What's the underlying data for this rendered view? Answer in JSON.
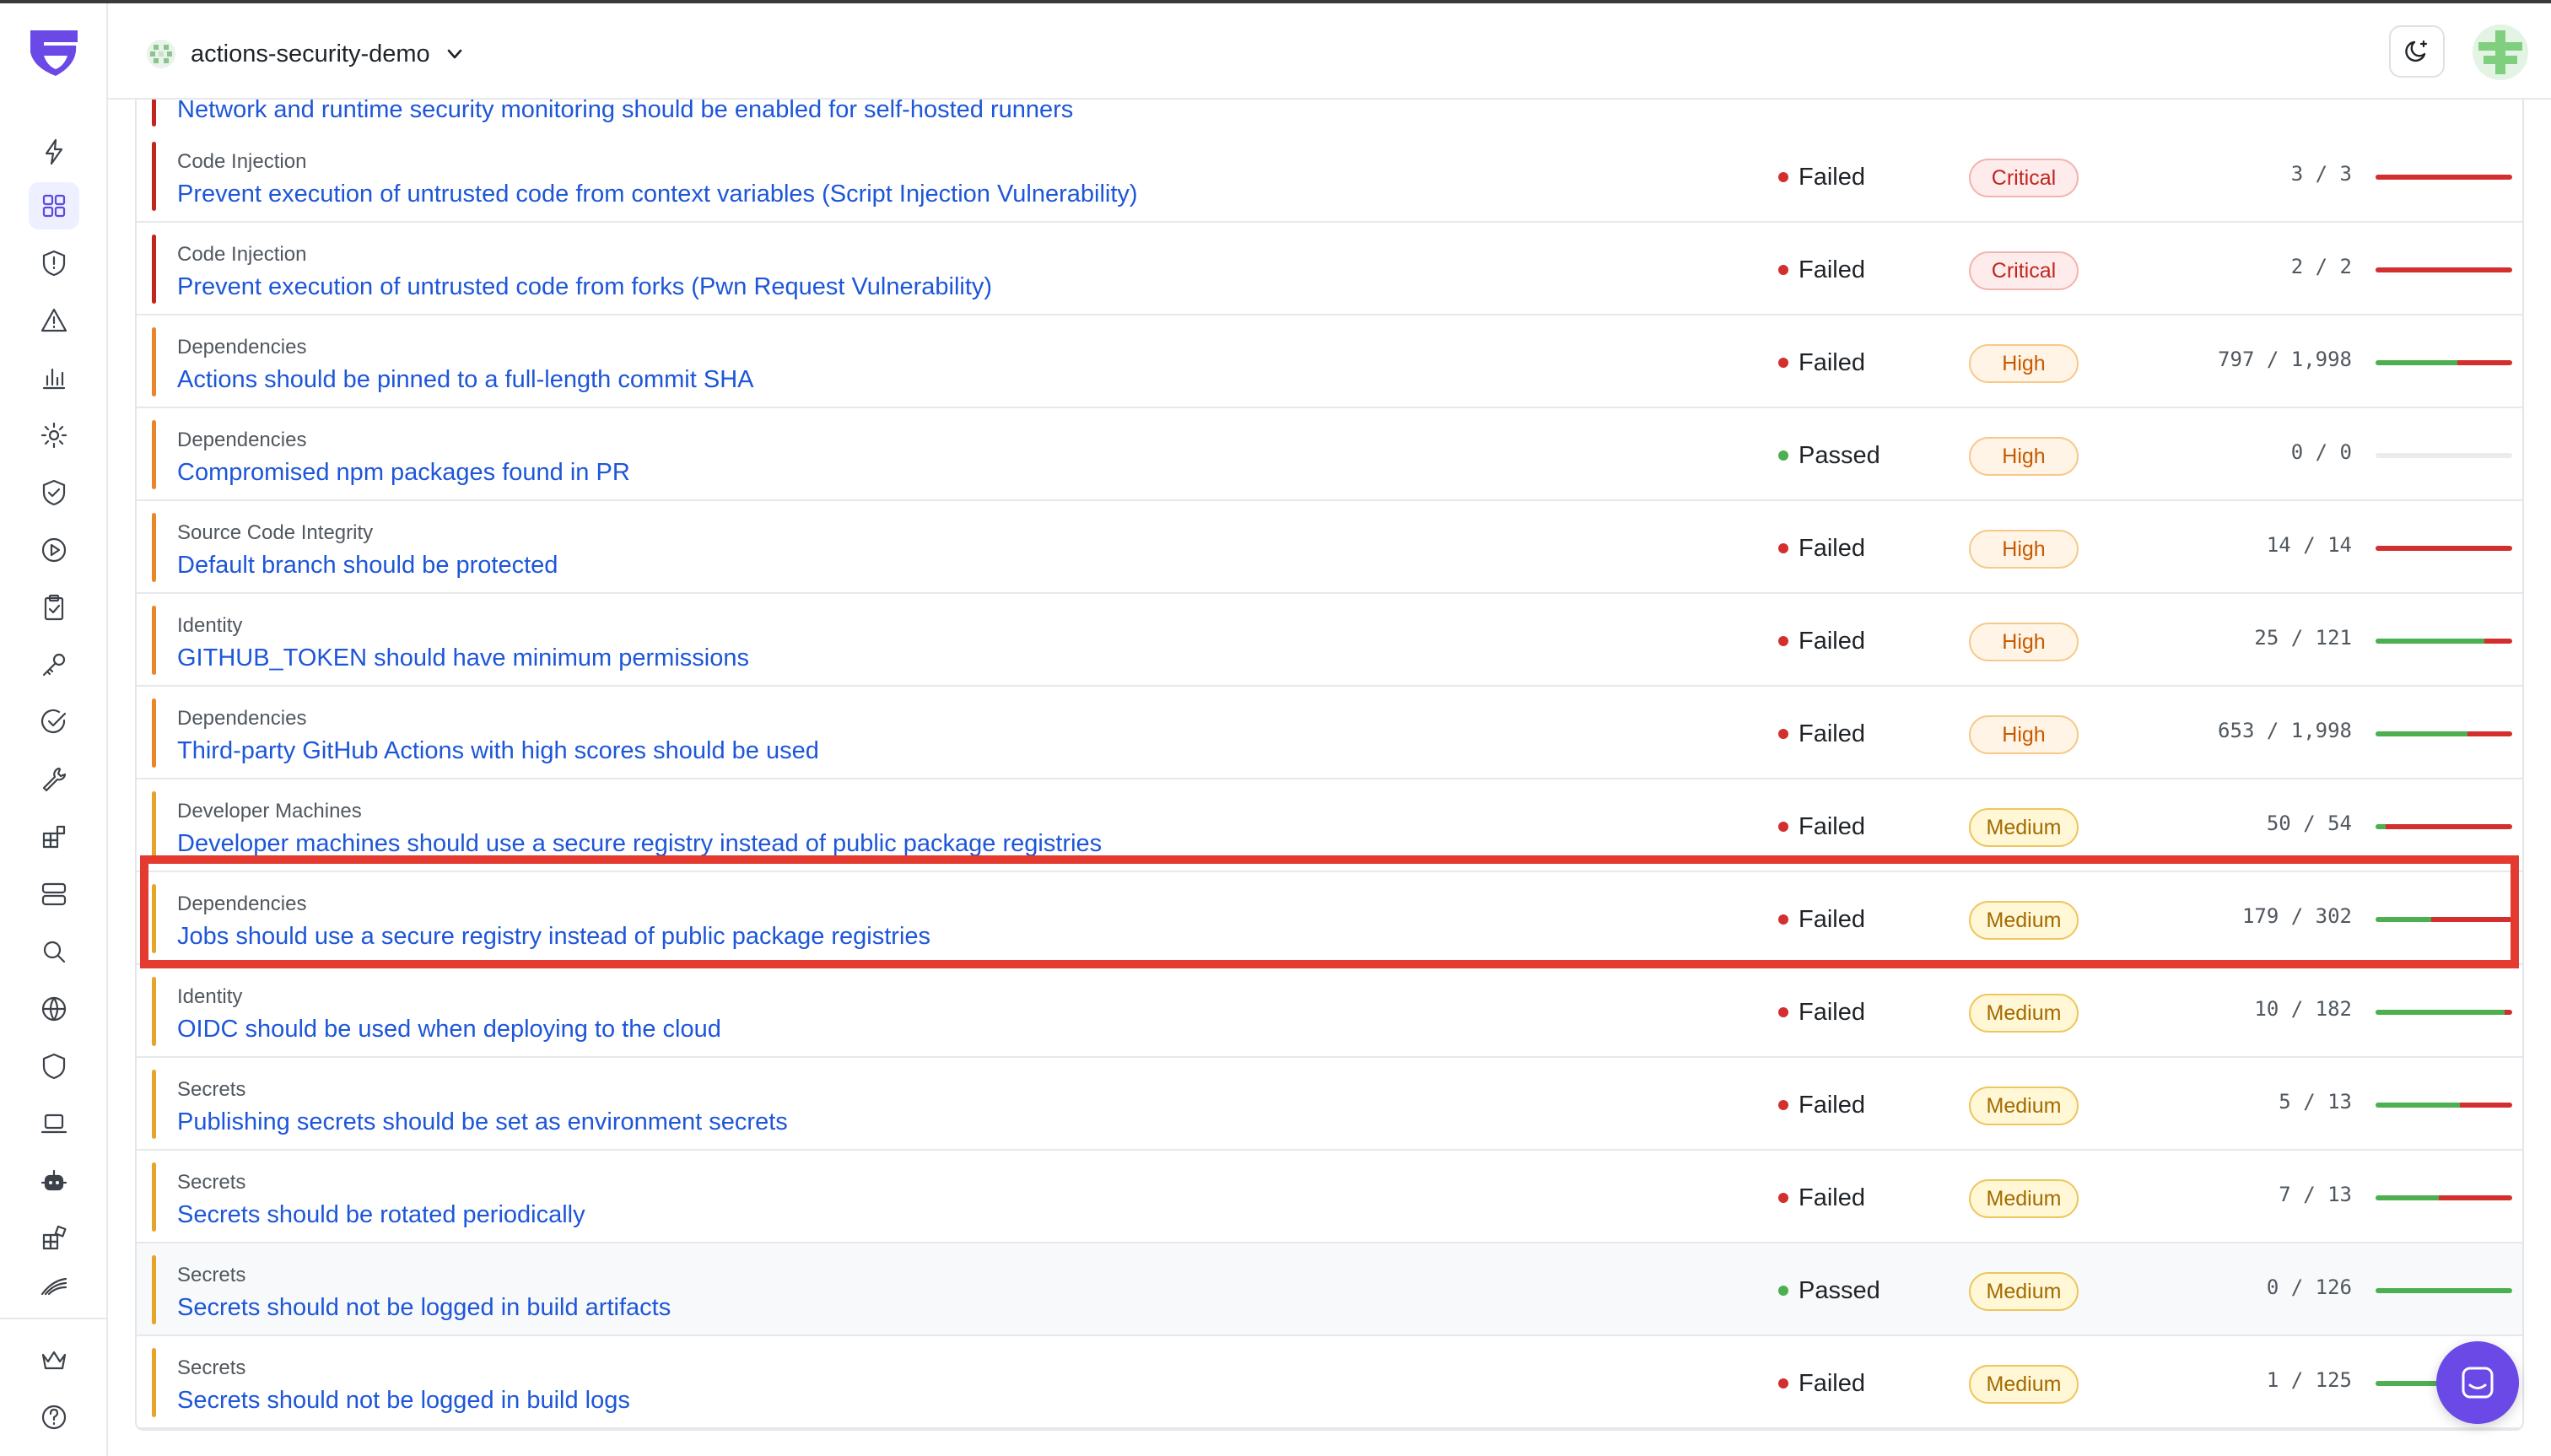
{
  "header": {
    "org_name": "actions-security-demo"
  },
  "colors": {
    "critical": "#c0261e",
    "high": "#e8862a",
    "medium": "#e4a52a",
    "failed": "#d32f2f",
    "passed": "#4caf50"
  },
  "sidebar": {
    "icons": [
      "bolt-icon",
      "dashboard-icon",
      "shield-alert-icon",
      "warning-icon",
      "bar-chart-icon",
      "settings-icon",
      "shield-check-icon",
      "play-circle-icon",
      "clipboard-check-icon",
      "key-icon",
      "check-circle-icon",
      "wrench-icon",
      "apps-icon",
      "server-icon",
      "search-icon",
      "globe-icon",
      "shield-icon",
      "laptop-icon",
      "robot-icon",
      "integrations-icon",
      "stack-icon",
      "crown-icon",
      "help-icon"
    ]
  },
  "rows": [
    {
      "category": "",
      "title": "Network and runtime security monitoring should be enabled for self-hosted runners",
      "status": "",
      "severity": "critical",
      "severity_label": "",
      "count": "",
      "failed": 0,
      "total": 0
    },
    {
      "category": "Code Injection",
      "title": "Prevent execution of untrusted code from context variables (Script Injection Vulnerability)",
      "status": "Failed",
      "severity": "critical",
      "severity_label": "Critical",
      "count": "3 / 3",
      "failed": 3,
      "total": 3
    },
    {
      "category": "Code Injection",
      "title": "Prevent execution of untrusted code from forks (Pwn Request Vulnerability)",
      "status": "Failed",
      "severity": "critical",
      "severity_label": "Critical",
      "count": "2 / 2",
      "failed": 2,
      "total": 2
    },
    {
      "category": "Dependencies",
      "title": "Actions should be pinned to a full-length commit SHA",
      "status": "Failed",
      "severity": "high",
      "severity_label": "High",
      "count": "797 / 1,998",
      "failed": 797,
      "total": 1998
    },
    {
      "category": "Dependencies",
      "title": "Compromised npm packages found in PR",
      "status": "Passed",
      "severity": "high",
      "severity_label": "High",
      "count": "0 / 0",
      "failed": 0,
      "total": 0
    },
    {
      "category": "Source Code Integrity",
      "title": "Default branch should be protected",
      "status": "Failed",
      "severity": "high",
      "severity_label": "High",
      "count": "14 / 14",
      "failed": 14,
      "total": 14
    },
    {
      "category": "Identity",
      "title": "GITHUB_TOKEN should have minimum permissions",
      "status": "Failed",
      "severity": "high",
      "severity_label": "High",
      "count": "25 / 121",
      "failed": 25,
      "total": 121
    },
    {
      "category": "Dependencies",
      "title": "Third-party GitHub Actions with high scores should be used",
      "status": "Failed",
      "severity": "high",
      "severity_label": "High",
      "count": "653 / 1,998",
      "failed": 653,
      "total": 1998
    },
    {
      "category": "Developer Machines",
      "title": "Developer machines should use a secure registry instead of public package registries",
      "status": "Failed",
      "severity": "medium",
      "severity_label": "Medium",
      "count": "50 / 54",
      "failed": 50,
      "total": 54
    },
    {
      "category": "Dependencies",
      "title": "Jobs should use a secure registry instead of public package registries",
      "status": "Failed",
      "severity": "medium",
      "severity_label": "Medium",
      "count": "179 / 302",
      "failed": 179,
      "total": 302
    },
    {
      "category": "Identity",
      "title": "OIDC should be used when deploying to the cloud",
      "status": "Failed",
      "severity": "medium",
      "severity_label": "Medium",
      "count": "10 / 182",
      "failed": 10,
      "total": 182
    },
    {
      "category": "Secrets",
      "title": "Publishing secrets should be set as environment secrets",
      "status": "Failed",
      "severity": "medium",
      "severity_label": "Medium",
      "count": "5 / 13",
      "failed": 5,
      "total": 13
    },
    {
      "category": "Secrets",
      "title": "Secrets should be rotated periodically",
      "status": "Failed",
      "severity": "medium",
      "severity_label": "Medium",
      "count": "7 / 13",
      "failed": 7,
      "total": 13
    },
    {
      "category": "Secrets",
      "title": "Secrets should not be logged in build artifacts",
      "status": "Passed",
      "severity": "medium",
      "severity_label": "Medium",
      "count": "0 / 126",
      "failed": 0,
      "total": 126
    },
    {
      "category": "Secrets",
      "title": "Secrets should not be logged in build logs",
      "status": "Failed",
      "severity": "medium",
      "severity_label": "Medium",
      "count": "1 / 125",
      "failed": 1,
      "total": 125
    }
  ]
}
